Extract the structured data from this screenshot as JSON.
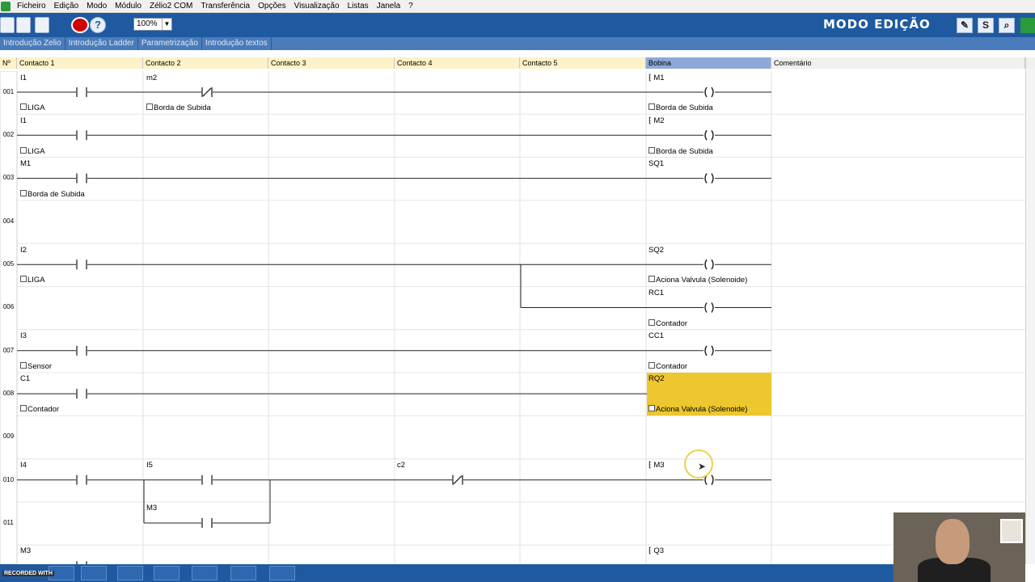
{
  "menubar": {
    "items": [
      "Ficheiro",
      "Edição",
      "Modo",
      "Módulo",
      "Zélio2 COM",
      "Transferência",
      "Opções",
      "Visualização",
      "Listas",
      "Janela",
      "?"
    ]
  },
  "toolbar": {
    "zoom_value": "100%",
    "mode_title": "MODO EDIÇÃO",
    "help_label": "?",
    "sim_label": "S",
    "icons": [
      "new-file-icon",
      "open-folder-icon",
      "save-icon",
      "stop-icon",
      "help-icon",
      "edit-mode-icon",
      "simulation-icon",
      "search-icon",
      "zelio-logo-icon"
    ]
  },
  "tabs": [
    "Introdução Zelio",
    "Introdução Ladder",
    "Parametrização",
    "Introdução textos"
  ],
  "columns": {
    "num": "Nº",
    "c1": "Contacto 1",
    "c2": "Contacto 2",
    "c3": "Contacto 3",
    "c4": "Contacto 4",
    "c5": "Contacto 5",
    "coil": "Bobina",
    "comment": "Comentário"
  },
  "rows": [
    "001",
    "002",
    "003",
    "004",
    "005",
    "006",
    "007",
    "008",
    "009",
    "010",
    "011"
  ],
  "ladder": {
    "r001": {
      "c1_name": "I1",
      "c1_comment": "LIGA",
      "c2_name": "m2",
      "c2_comment": "Borda de Subida",
      "coil_name": "M1",
      "coil_comment": "Borda de Subida"
    },
    "r002": {
      "c1_name": "I1",
      "c1_comment": "LIGA",
      "coil_name": "M2",
      "coil_comment": "Borda de Subida"
    },
    "r003": {
      "c1_name": "M1",
      "c1_comment": "Borda de Subida",
      "coil_name": "SQ1"
    },
    "r005": {
      "c1_name": "I2",
      "c1_comment": "LIGA",
      "coil_name": "SQ2",
      "coil_comment": "Aciona Valvula (Solenoide)"
    },
    "r006": {
      "coil_name": "RC1",
      "coil_comment": "Contador"
    },
    "r007": {
      "c1_name": "I3",
      "c1_comment": "Sensor",
      "coil_name": "CC1",
      "coil_comment": "Contador"
    },
    "r008": {
      "c1_name": "C1",
      "c1_comment": "Contador",
      "coil_name": "RQ2",
      "coil_comment": "Aciona Valvula (Solenoide)"
    },
    "r010": {
      "c1_name": "I4",
      "c2_name": "I5",
      "c4_name": "c2",
      "coil_name": "M3"
    },
    "r011": {
      "c2_name": "M3"
    },
    "r012": {
      "c1_name": "M3",
      "coil_name": "Q3"
    }
  },
  "coil_symbol": "( )",
  "colors": {
    "toolbar_bg": "#1f5aa0",
    "tab_bg": "#4a7cbb",
    "header_yellow": "#fdf2c8",
    "coil_header": "#8ea9d8",
    "highlight": "#ecc72e"
  },
  "watermark": "RECORDED WITH"
}
